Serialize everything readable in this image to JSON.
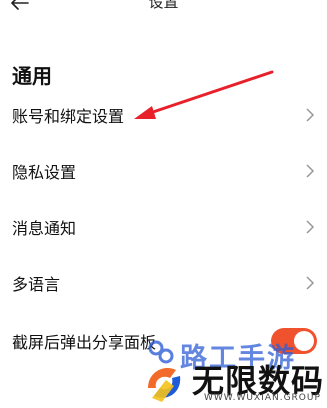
{
  "header": {
    "title": "设置",
    "back_icon": "arrow-left-icon"
  },
  "section": {
    "title": "通用"
  },
  "rows": [
    {
      "label": "账号和绑定设置",
      "control": "chevron"
    },
    {
      "label": "隐私设置",
      "control": "chevron"
    },
    {
      "label": "消息通知",
      "control": "chevron"
    },
    {
      "label": "多语言",
      "control": "chevron"
    },
    {
      "label": "截屏后弹出分享面板",
      "control": "toggle",
      "enabled": true
    }
  ],
  "watermark": {
    "partial_text": "路工手游",
    "brand": "无限数码",
    "brand_sub": "WWW.WUXIAN.GROUP"
  },
  "colors": {
    "accent": "#f0522e",
    "annotation_arrow": "#e8202a",
    "watermark_blue": "#2f5fd6"
  }
}
